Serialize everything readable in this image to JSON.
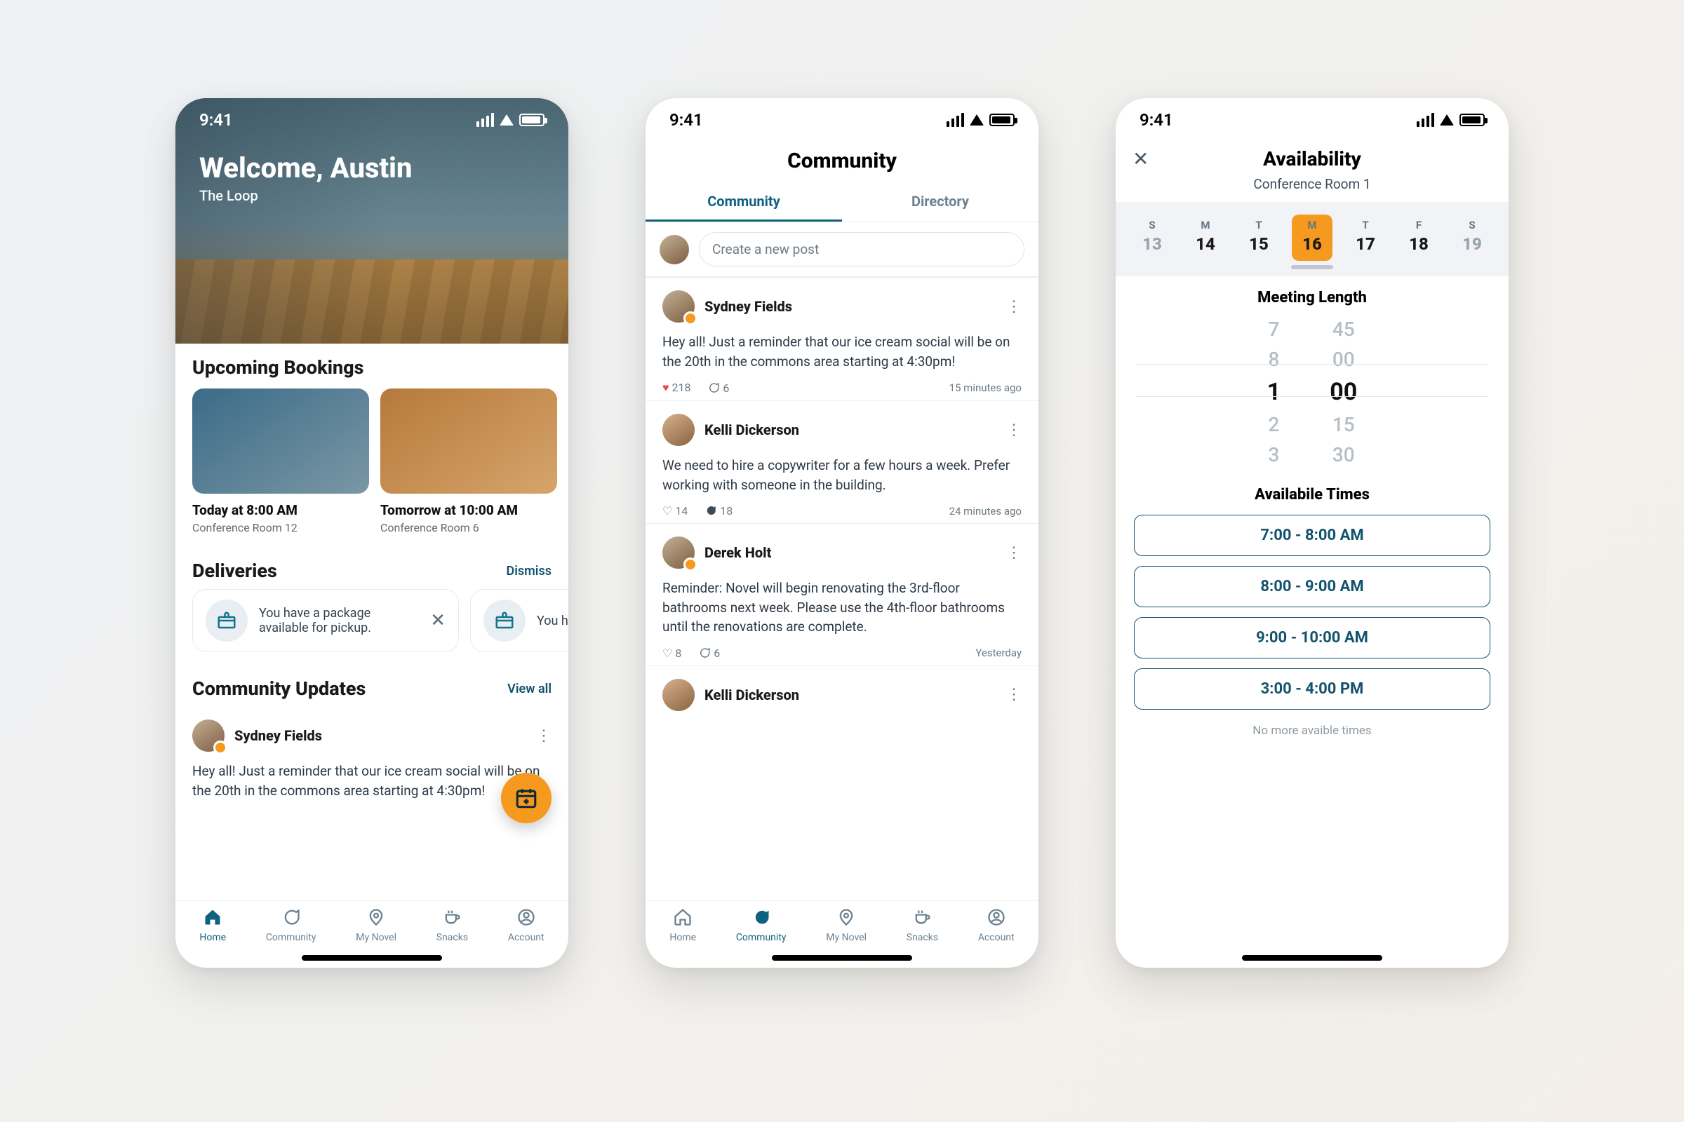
{
  "status": {
    "time": "9:41"
  },
  "home": {
    "welcome": "Welcome, Austin",
    "location": "The Loop",
    "upcoming_title": "Upcoming Bookings",
    "bookings": [
      {
        "when": "Today at 8:00 AM",
        "room": "Conference Room 12"
      },
      {
        "when": "Tomorrow at 10:00 AM",
        "room": "Conference Room 6"
      }
    ],
    "deliveries_title": "Deliveries",
    "deliveries_dismiss": "Dismiss",
    "delivery_text": "You have a package available for pickup.",
    "delivery_text_partial": "You have a package avail",
    "community_title": "Community Updates",
    "community_link": "View all",
    "post_name": "Sydney Fields",
    "post_body": "Hey all! Just a reminder that our ice cream social will be on the 20th in the commons area starting at 4:30pm!"
  },
  "tabs": {
    "home": "Home",
    "community": "Community",
    "mynovel": "My Novel",
    "snacks": "Snacks",
    "account": "Account"
  },
  "community": {
    "title": "Community",
    "tab1": "Community",
    "tab2": "Directory",
    "newpost_placeholder": "Create a new post",
    "posts": [
      {
        "name": "Sydney Fields",
        "body": "Hey all! Just a reminder that our ice cream social will be on the 20th in the commons area starting at 4:30pm!",
        "likes": "218",
        "comments": "6",
        "time": "15 minutes ago",
        "liked": true
      },
      {
        "name": "Kelli Dickerson",
        "body": "We need to hire a copywriter for a few hours a week. Prefer working with someone in the building.",
        "likes": "14",
        "comments": "18",
        "time": "24 minutes ago",
        "liked": false
      },
      {
        "name": "Derek Holt",
        "body": "Reminder: Novel will begin renovating the 3rd-floor bathrooms next week. Please use the 4th-floor bathrooms until the renovations are complete.",
        "likes": "8",
        "comments": "6",
        "time": "Yesterday",
        "liked": false
      },
      {
        "name": "Kelli Dickerson",
        "body": "",
        "likes": "",
        "comments": "",
        "time": "",
        "liked": false
      }
    ]
  },
  "availability": {
    "title": "Availability",
    "room": "Conference Room 1",
    "days": [
      {
        "dow": "S",
        "day": "13",
        "muted": true
      },
      {
        "dow": "M",
        "day": "14"
      },
      {
        "dow": "T",
        "day": "15"
      },
      {
        "dow": "M",
        "day": "16",
        "active": true
      },
      {
        "dow": "T",
        "day": "17"
      },
      {
        "dow": "F",
        "day": "18"
      },
      {
        "dow": "S",
        "day": "19",
        "muted": true
      }
    ],
    "meeting_length_title": "Meeting Length",
    "hours": [
      "7",
      "8",
      "1",
      "2",
      "3"
    ],
    "mins": [
      "45",
      "00",
      "00",
      "15",
      "30"
    ],
    "available_title": "Availabile Times",
    "slots": [
      "7:00 - 8:00 AM",
      "8:00 - 9:00 AM",
      "9:00 - 10:00 AM",
      "3:00 - 4:00 PM"
    ],
    "no_more": "No more avaible times"
  }
}
